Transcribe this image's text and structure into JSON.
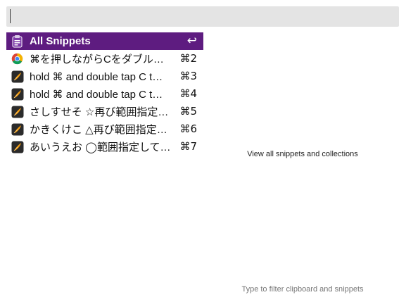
{
  "search": {
    "value": "",
    "placeholder": ""
  },
  "results": [
    {
      "label": "All Snippets",
      "shortcut": "↩",
      "icon": "snippets-clipboard-icon",
      "selected": true
    },
    {
      "label": "⌘を押しながらCをダブル…",
      "shortcut": "⌘2",
      "icon": "chrome-icon",
      "selected": false
    },
    {
      "label": "hold ⌘ and double tap C t…",
      "shortcut": "⌘3",
      "icon": "quill-app-icon",
      "selected": false
    },
    {
      "label": "hold ⌘ and double tap C t…",
      "shortcut": "⌘4",
      "icon": "quill-app-icon",
      "selected": false
    },
    {
      "label": "さしすせそ ☆再び範囲指定…",
      "shortcut": "⌘5",
      "icon": "quill-app-icon",
      "selected": false
    },
    {
      "label": "かきくけこ △再び範囲指定…",
      "shortcut": "⌘6",
      "icon": "quill-app-icon",
      "selected": false
    },
    {
      "label": "あいうえお ◯範囲指定して…",
      "shortcut": "⌘7",
      "icon": "quill-app-icon",
      "selected": false
    }
  ],
  "preview": {
    "text": "View all snippets and collections"
  },
  "footer": {
    "hint": "Type to filter clipboard and snippets"
  },
  "colors": {
    "selection": "#5e1c80",
    "search_background": "#e4e4e4"
  }
}
